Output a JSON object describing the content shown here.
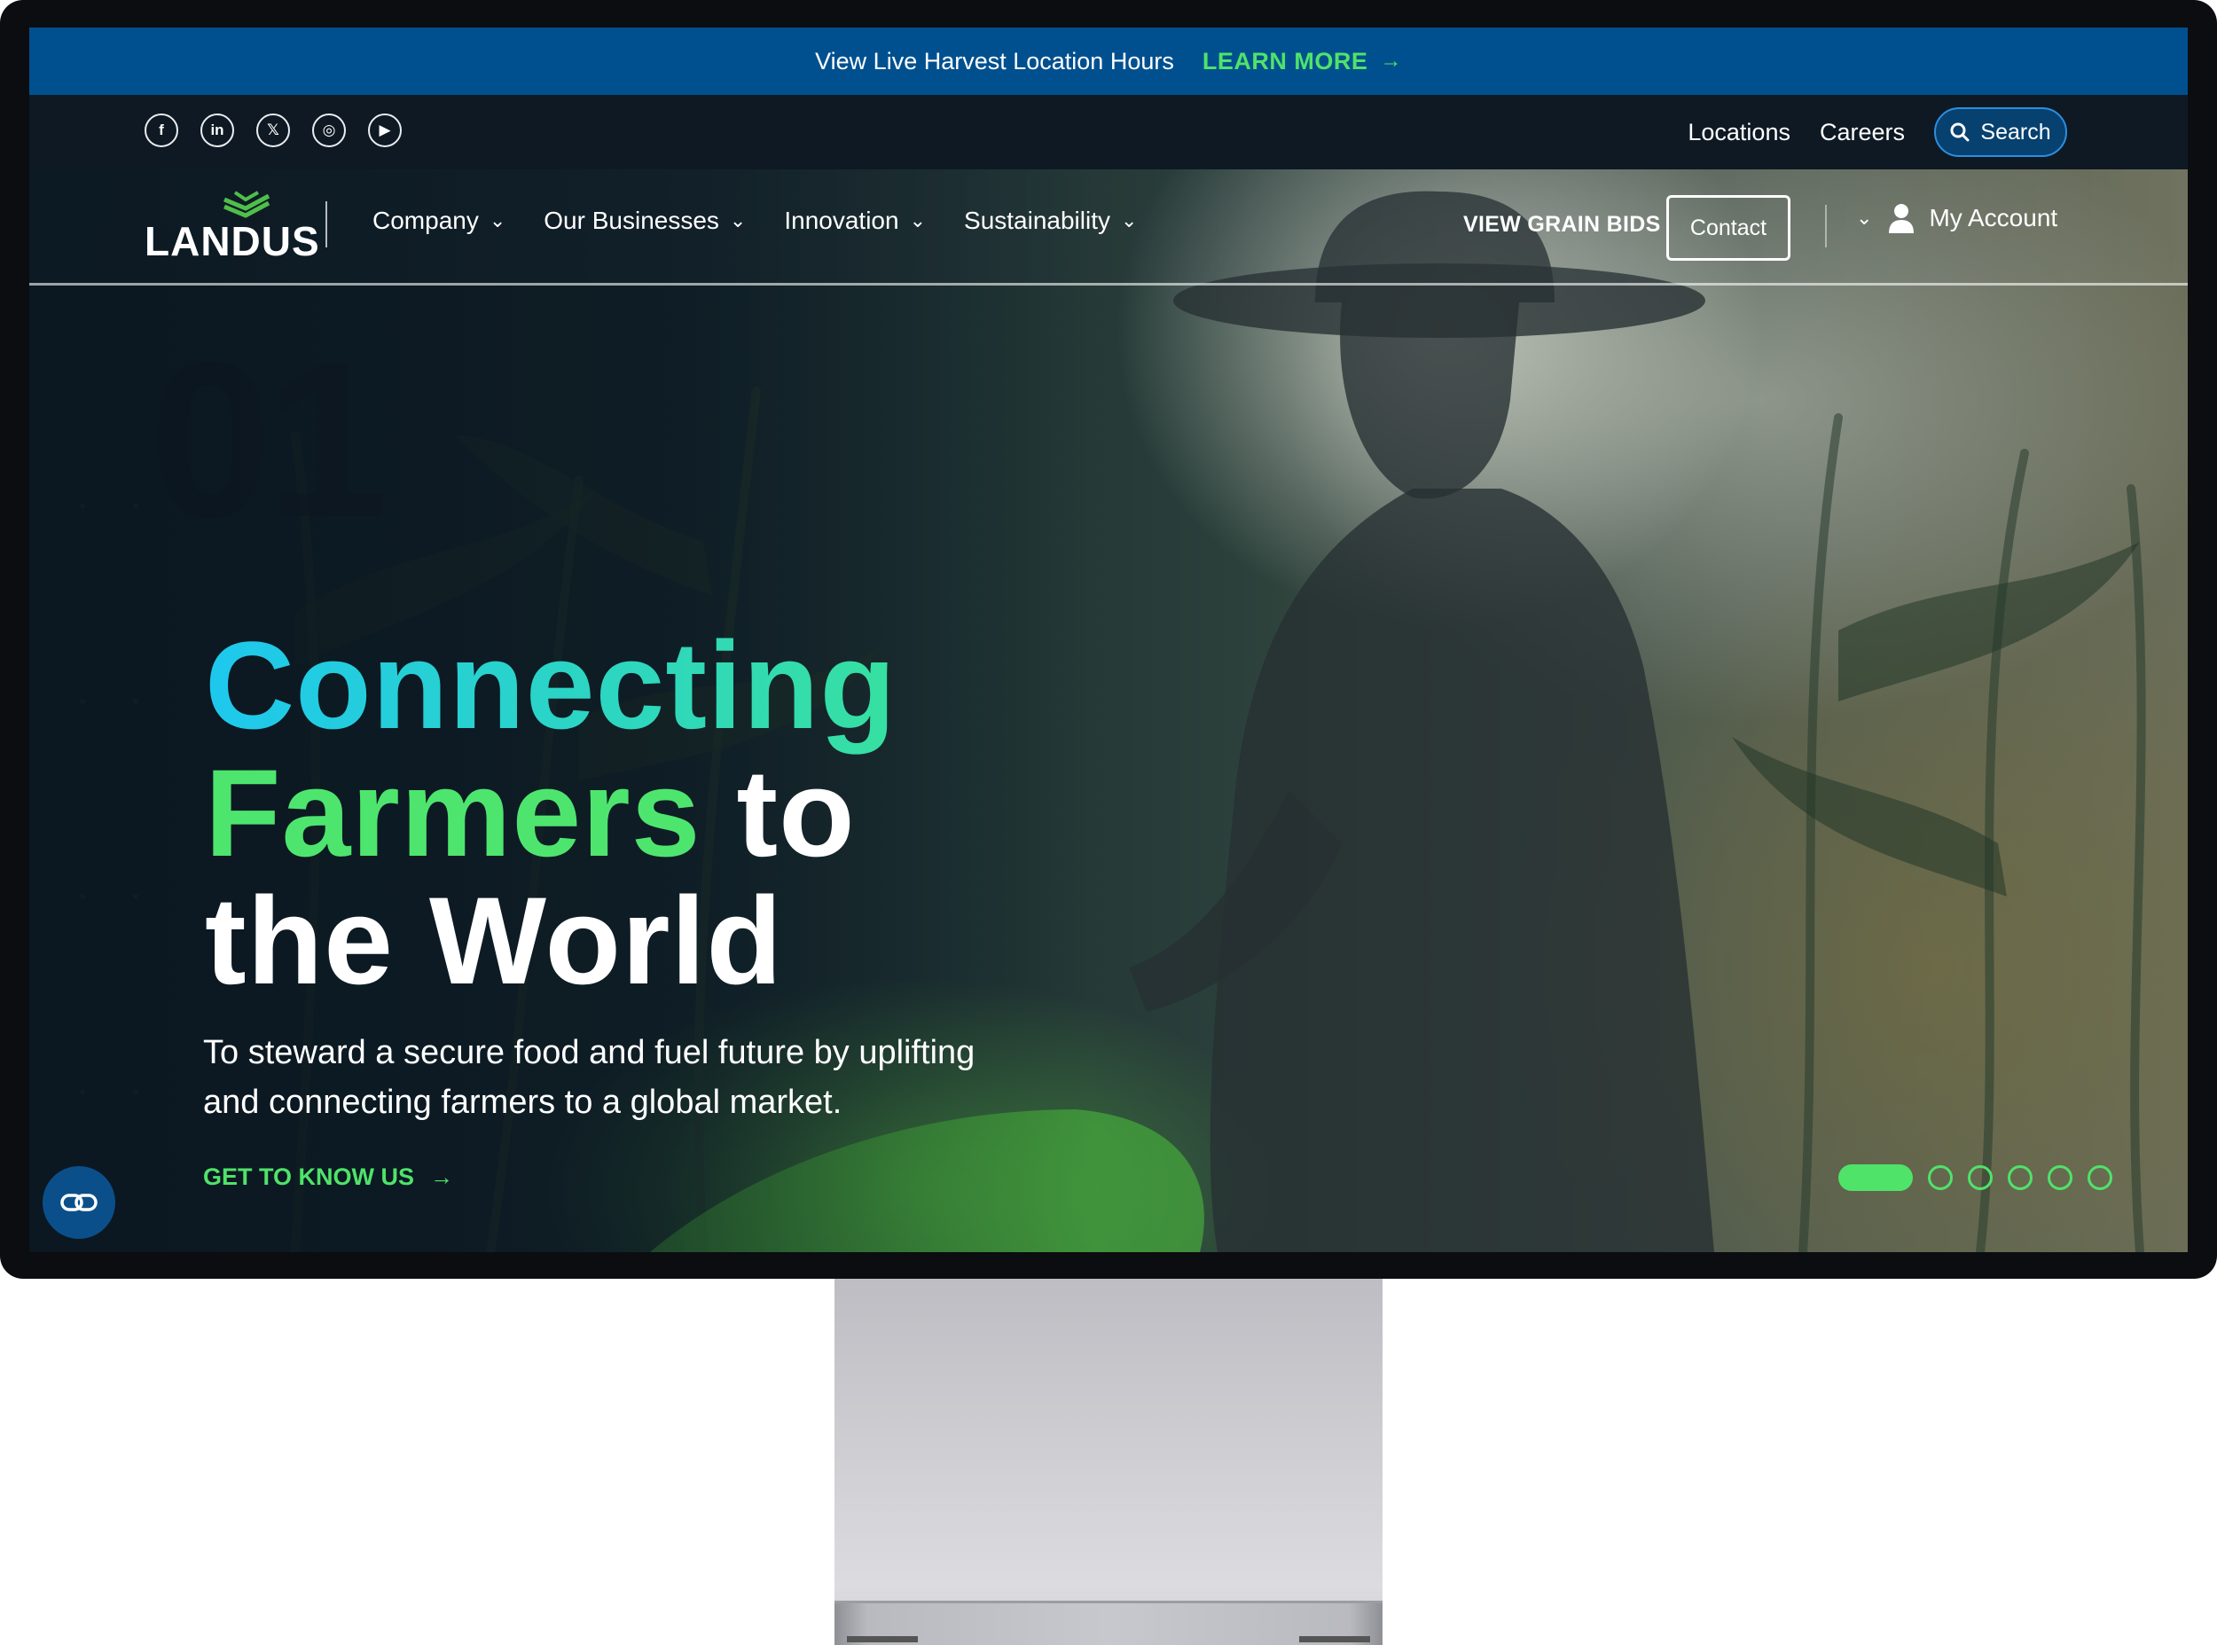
{
  "banner": {
    "text": "View Live Harvest Location Hours",
    "link_label": "LEARN MORE",
    "link_arrow": "→"
  },
  "socials": [
    {
      "icon": "facebook-icon",
      "glyph": "f"
    },
    {
      "icon": "linkedin-icon",
      "glyph": "in"
    },
    {
      "icon": "x-twitter-icon",
      "glyph": "𝕏"
    },
    {
      "icon": "instagram-icon",
      "glyph": "◎"
    },
    {
      "icon": "youtube-icon",
      "glyph": "▶"
    }
  ],
  "utility": {
    "locations": "Locations",
    "careers": "Careers",
    "search": "Search"
  },
  "logo": {
    "text": "LANDUS"
  },
  "nav": {
    "items": [
      {
        "label": "Company"
      },
      {
        "label": "Our Businesses"
      },
      {
        "label": "Innovation"
      },
      {
        "label": "Sustainability"
      }
    ],
    "grain_bids": "VIEW GRAIN BIDS",
    "contact": "Contact",
    "account": "My Account"
  },
  "hero": {
    "number": "01",
    "headline_line1": "Connecting",
    "headline_line2a": "Farmers",
    "headline_line2b": "to",
    "headline_line3": "the World",
    "subtext": "To steward a secure food and fuel future by uplifting and connecting farmers to a global market.",
    "cta": "GET TO KNOW US",
    "cta_arrow": "→",
    "slides_total": 6,
    "slide_active": 1
  },
  "colors": {
    "banner": "#00508f",
    "accent_green": "#4fe36a",
    "accent_cyan": "#1ec8ee",
    "nav_dark": "#0f1923"
  }
}
